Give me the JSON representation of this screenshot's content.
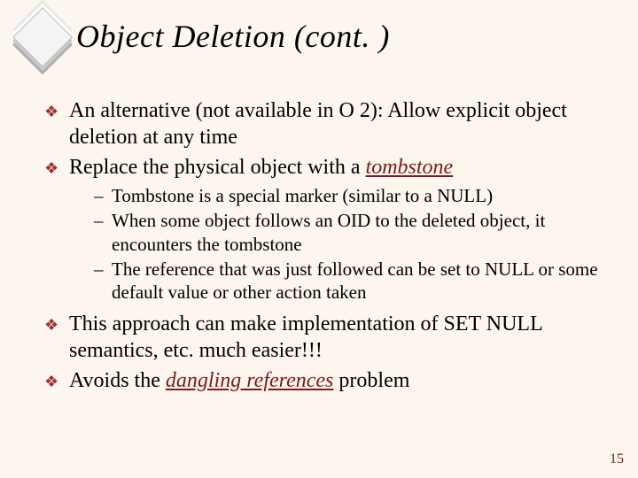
{
  "title": "Object Deletion (cont. )",
  "bullets": {
    "b1": "An alternative (not available in O 2):  Allow explicit object deletion at any time",
    "b2_pre": "Replace the physical object with a ",
    "b2_ul": "tombstone",
    "sub1": "Tombstone is a special marker (similar to a NULL)",
    "sub2": "When some object follows an OID to the deleted object, it encounters the tombstone",
    "sub3": "The reference that was just followed can be set to NULL or some default value or other action taken",
    "b3": "This approach can make implementation of SET NULL semantics, etc. much easier!!!",
    "b4_pre": "Avoids the ",
    "b4_ul": "dangling references",
    "b4_post": " problem"
  },
  "page_number": "15"
}
